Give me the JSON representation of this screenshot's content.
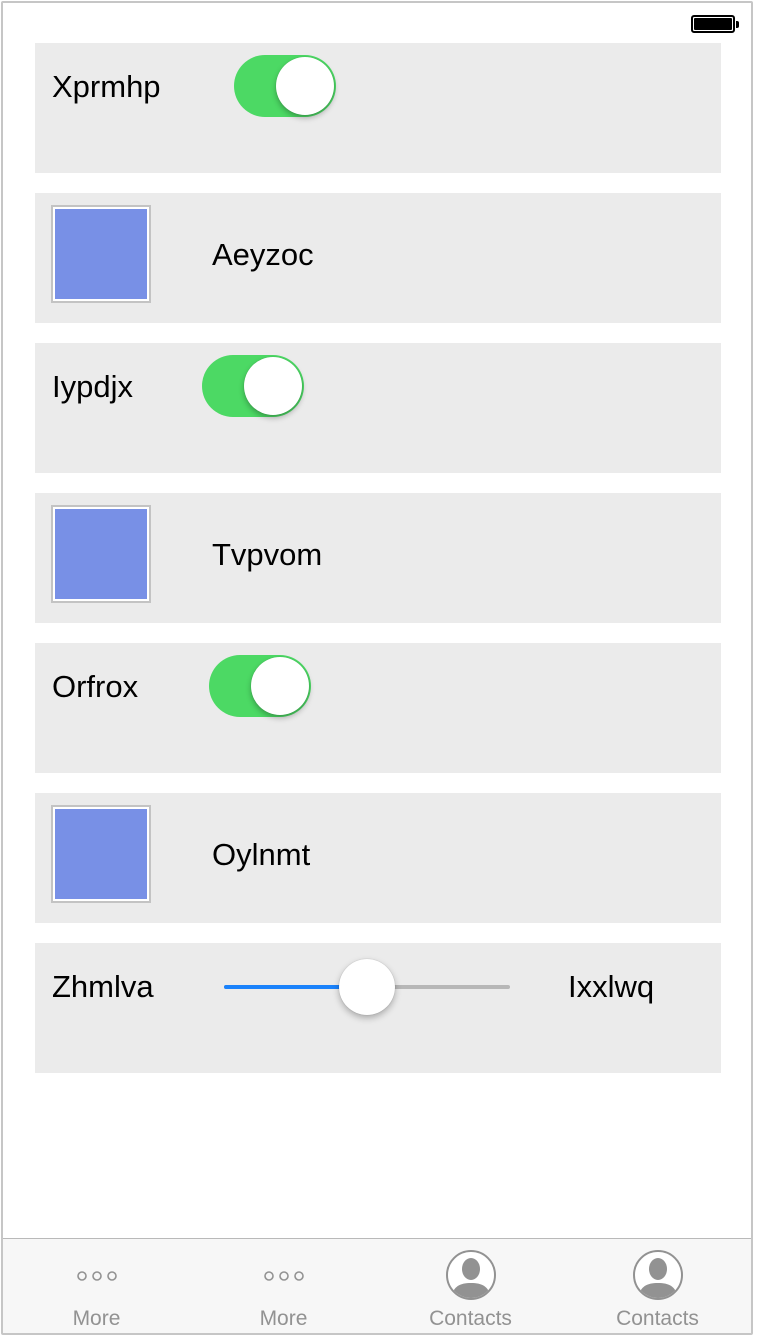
{
  "colors": {
    "toggle_on": "#4cd964",
    "swatch": "#7890e6",
    "slider_min_track": "#1a82fb",
    "slider_max_track": "#b7b7b7",
    "tab_inactive": "#929292"
  },
  "status_bar": {
    "battery_icon": "battery-full-icon",
    "battery_level": 1.0
  },
  "rows": {
    "r0": {
      "type": "toggle",
      "label": "Xprmhp",
      "on": true
    },
    "r1": {
      "type": "swatch",
      "title": "Aeyzoc"
    },
    "r2": {
      "type": "toggle",
      "label": "Iypdjx",
      "on": true
    },
    "r3": {
      "type": "swatch",
      "title": "Tvpvom"
    },
    "r4": {
      "type": "toggle",
      "label": "Orfrox",
      "on": true
    },
    "r5": {
      "type": "swatch",
      "title": "Oylnmt"
    },
    "r6": {
      "type": "slider",
      "min_label": "Zhmlva",
      "max_label": "Ixxlwq",
      "value": 0.5
    }
  },
  "tab_bar": {
    "tabs": [
      {
        "label": "More",
        "icon": "more-icon"
      },
      {
        "label": "More",
        "icon": "more-icon"
      },
      {
        "label": "Contacts",
        "icon": "contacts-icon"
      },
      {
        "label": "Contacts",
        "icon": "contacts-icon"
      }
    ]
  }
}
